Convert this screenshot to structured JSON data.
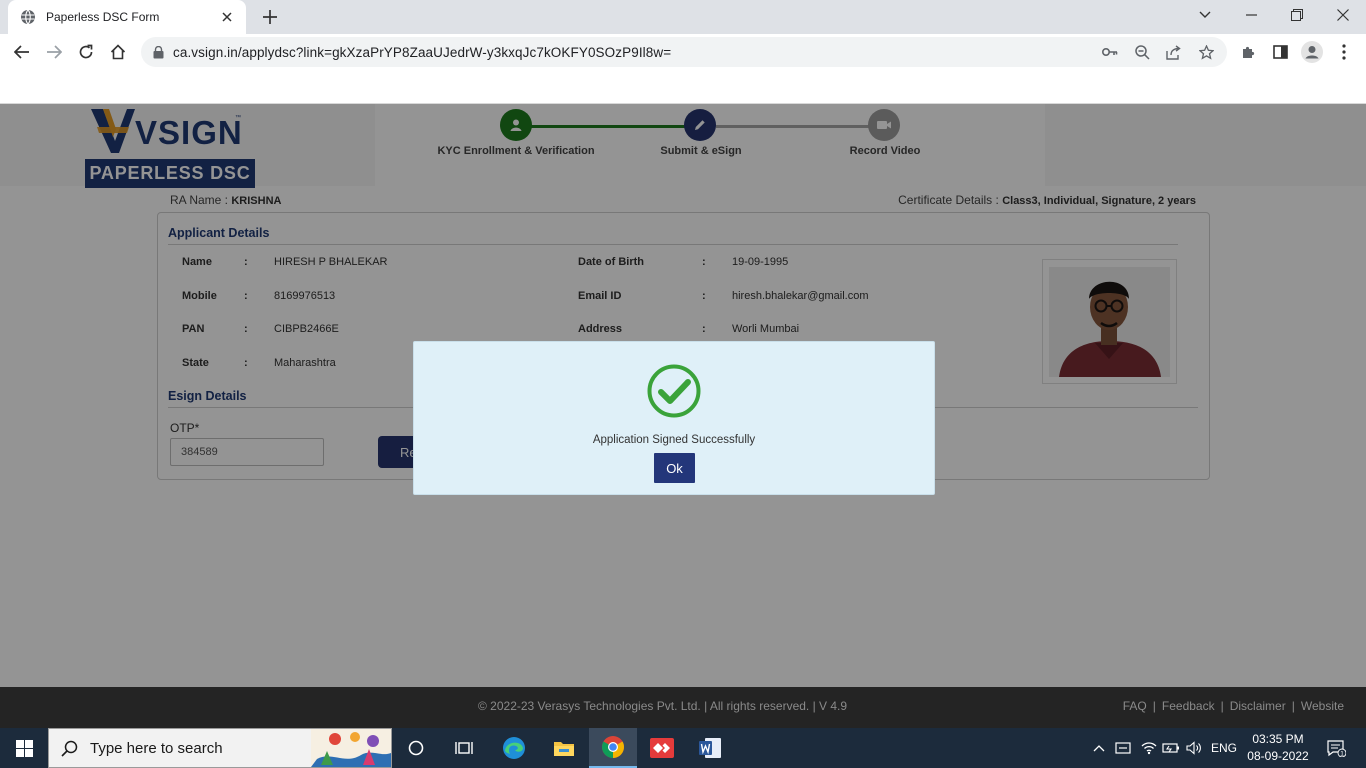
{
  "browser": {
    "tab_title": "Paperless DSC Form",
    "url": "ca.vsign.in/applydsc?link=gkXzaPrYP8ZaaUJedrW-y3kxqJc7kOKFY0SOzP9Il8w="
  },
  "brand": {
    "logo_text": "VSIGN",
    "badge_text": "PAPERLESS DSC"
  },
  "steps": [
    {
      "label": "KYC Enrollment & Verification",
      "status": "completed",
      "icon": "user-icon"
    },
    {
      "label": "Submit & eSign",
      "status": "current",
      "icon": "pen-icon"
    },
    {
      "label": "Record Video",
      "status": "pending",
      "icon": "video-icon"
    }
  ],
  "meta": {
    "ra_label": "RA Name : ",
    "ra_value": "KRISHNA",
    "cert_label": "Certificate Details : ",
    "cert_value": "Class3, Individual, Signature, 2 years"
  },
  "applicant": {
    "section_title": "Applicant Details",
    "separator": ":",
    "fields": {
      "name": {
        "label": "Name",
        "value": "HIRESH P BHALEKAR"
      },
      "mobile": {
        "label": "Mobile",
        "value": "8169976513"
      },
      "pan": {
        "label": "PAN",
        "value": "CIBPB2466E"
      },
      "state": {
        "label": "State",
        "value": "Maharashtra"
      },
      "dob": {
        "label": "Date of Birth",
        "value": "19-09-1995"
      },
      "email": {
        "label": "Email ID",
        "value": "hiresh.bhalekar@gmail.com"
      },
      "address": {
        "label": "Address",
        "value": "Worli Mumbai"
      }
    }
  },
  "esign": {
    "section_title": "Esign Details",
    "otp_label": "OTP*",
    "otp_value": "384589",
    "resend_label": "Re"
  },
  "modal": {
    "message": "Application Signed Successfully",
    "ok_label": "Ok"
  },
  "footer": {
    "copyright": "© 2022-23  Verasys Technologies Pvt. Ltd. | All rights reserved. | V 4.9",
    "links": [
      "FAQ",
      "Feedback",
      "Disclaimer",
      "Website"
    ],
    "link_separator": "|"
  },
  "taskbar": {
    "search_placeholder": "Type here to search",
    "language": "ENG",
    "time": "03:35 PM",
    "date": "08-09-2022",
    "notification_count": "1"
  },
  "colors": {
    "brand_navy": "#1f3a74",
    "step_done": "#1e7b1e",
    "step_current": "#27356f",
    "step_pending": "#9e9e9e",
    "success_green": "#3aa33a",
    "modal_bg": "#dff0f8"
  }
}
